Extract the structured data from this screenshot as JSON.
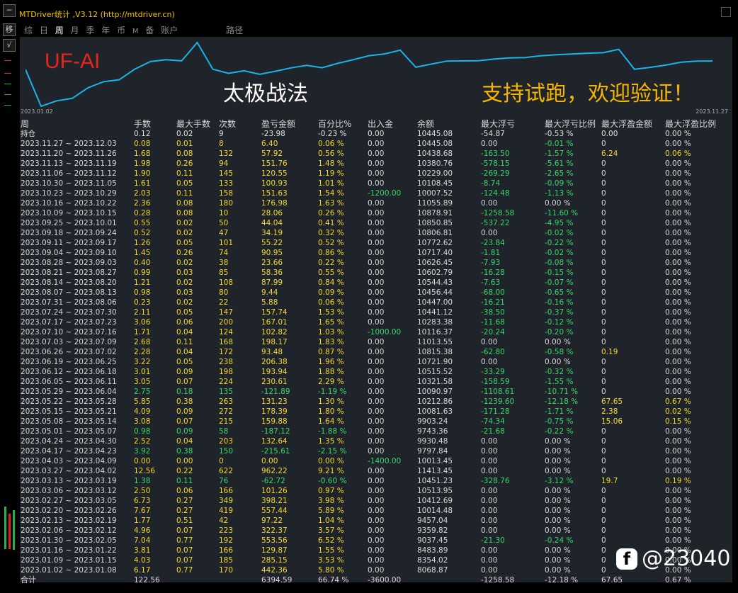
{
  "window": {
    "title": "MTDriver统计 ,V3.12 (http://mtdriver.cn)"
  },
  "left_buttons": [
    "─",
    "移",
    "√"
  ],
  "tabs": [
    {
      "label": "综"
    },
    {
      "label": "日"
    },
    {
      "label": "周",
      "active": true
    },
    {
      "label": "月"
    },
    {
      "label": "季"
    },
    {
      "label": "年"
    },
    {
      "label": "币"
    },
    {
      "label": "M"
    },
    {
      "label": "备"
    },
    {
      "label": "账户"
    },
    {
      "label": "路径"
    }
  ],
  "curve": {
    "start_date": "2023.01.02",
    "end_date": "2023.11.27",
    "line_color": "#19b4e8",
    "balances": [
      10000,
      8068.87,
      8354.02,
      8483.89,
      9037.45,
      9359.82,
      9457.04,
      10014.48,
      10412.69,
      10513.95,
      10451.23,
      11413.45,
      10013.45,
      9797.84,
      9930.48,
      9743.36,
      9903.24,
      10081.63,
      10212.86,
      10090.97,
      10321.58,
      10515.52,
      10721.9,
      10815.38,
      11013.55,
      10116.37,
      10283.38,
      10441.12,
      10447.0,
      10456.44,
      10544.43,
      10602.79,
      10626.45,
      10717.4,
      10772.62,
      10806.81,
      10850.85,
      10878.91,
      11055.89,
      10007.52,
      10108.45,
      10229.0,
      10380.76,
      10438.68,
      10445.08
    ]
  },
  "overlay": {
    "brand": "UF-AI",
    "caption_left": "太极战法",
    "caption_right": "支持试跑，欢迎验证！",
    "brand_color": "#e8241c",
    "caption_right_color": "#f5b400"
  },
  "table": {
    "headers": [
      "周",
      "手数",
      "最大手数",
      "次数",
      "盈亏金额",
      "百分比%",
      "出入金",
      "余额",
      "最大浮亏",
      "最大浮亏比例",
      "最大浮盈金额",
      "最大浮盈比例"
    ],
    "rows": [
      [
        "持仓",
        "0.12",
        "0.02",
        "9",
        "-23.98",
        "-0.23 %",
        "0.00",
        "10445.08",
        "-54.87",
        "-0.53 %",
        "0.00",
        "0.00 %"
      ],
      [
        "2023.11.27 ~ 2023.12.03",
        "0.08",
        "0.01",
        "8",
        "6.40",
        "0.06 %",
        "0.00",
        "10445.08",
        "0.00",
        "-0.01 %",
        "0",
        "0.00 %"
      ],
      [
        "2023.11.20 ~ 2023.11.26",
        "1.68",
        "0.08",
        "132",
        "57.92",
        "0.56 %",
        "0.00",
        "10438.68",
        "-163.50",
        "-1.57 %",
        "6.24",
        "0.06 %"
      ],
      [
        "2023.11.13 ~ 2023.11.19",
        "1.98",
        "0.26",
        "94",
        "151.76",
        "1.48 %",
        "0.00",
        "10380.76",
        "-578.15",
        "-5.61 %",
        "0",
        "0.00 %"
      ],
      [
        "2023.11.06 ~ 2023.11.12",
        "1.90",
        "0.11",
        "145",
        "120.55",
        "1.19 %",
        "0.00",
        "10229.00",
        "-269.29",
        "-2.65 %",
        "0",
        "0.00 %"
      ],
      [
        "2023.10.30 ~ 2023.11.05",
        "1.61",
        "0.05",
        "133",
        "100.93",
        "1.01 %",
        "0.00",
        "10108.45",
        "-8.74",
        "-0.09 %",
        "0",
        "0.00 %"
      ],
      [
        "2023.10.23 ~ 2023.10.29",
        "2.03",
        "0.11",
        "158",
        "151.63",
        "1.54 %",
        "-1200.00",
        "10007.52",
        "-124.48",
        "-1.13 %",
        "0",
        "0.00 %"
      ],
      [
        "2023.10.16 ~ 2023.10.22",
        "2.36",
        "0.08",
        "180",
        "176.98",
        "1.63 %",
        "0.00",
        "11055.89",
        "0.00",
        "0.00 %",
        "0",
        "0.00 %"
      ],
      [
        "2023.10.09 ~ 2023.10.15",
        "0.28",
        "0.08",
        "10",
        "28.06",
        "0.26 %",
        "0.00",
        "10878.91",
        "-1258.58",
        "-11.60 %",
        "0",
        "0.00 %"
      ],
      [
        "2023.09.25 ~ 2023.10.01",
        "0.55",
        "0.02",
        "50",
        "44.04",
        "0.41 %",
        "0.00",
        "10850.85",
        "-537.22",
        "-4.95 %",
        "0",
        "0.00 %"
      ],
      [
        "2023.09.18 ~ 2023.09.24",
        "0.52",
        "0.02",
        "47",
        "34.19",
        "0.32 %",
        "0.00",
        "10806.81",
        "0.00",
        "-0.02 %",
        "0",
        "0.00 %"
      ],
      [
        "2023.09.11 ~ 2023.09.17",
        "1.26",
        "0.05",
        "101",
        "55.22",
        "0.52 %",
        "0.00",
        "10772.62",
        "-23.84",
        "-0.22 %",
        "0",
        "0.00 %"
      ],
      [
        "2023.09.04 ~ 2023.09.10",
        "1.45",
        "0.26",
        "74",
        "90.95",
        "0.86 %",
        "0.00",
        "10717.40",
        "-1.81",
        "-0.02 %",
        "0",
        "0.00 %"
      ],
      [
        "2023.08.28 ~ 2023.09.03",
        "0.40",
        "0.02",
        "38",
        "23.66",
        "0.22 %",
        "0.00",
        "10626.45",
        "-7.93",
        "-0.08 %",
        "0",
        "0.00 %"
      ],
      [
        "2023.08.21 ~ 2023.08.27",
        "0.99",
        "0.03",
        "85",
        "58.36",
        "0.55 %",
        "0.00",
        "10602.79",
        "-16.28",
        "-0.15 %",
        "0",
        "0.00 %"
      ],
      [
        "2023.08.14 ~ 2023.08.20",
        "1.21",
        "0.02",
        "108",
        "87.99",
        "0.84 %",
        "0.00",
        "10544.43",
        "-7.63",
        "-0.07 %",
        "0",
        "0.00 %"
      ],
      [
        "2023.08.07 ~ 2023.08.13",
        "0.98",
        "0.03",
        "80",
        "9.44",
        "0.09 %",
        "0.00",
        "10456.44",
        "-68.00",
        "-0.65 %",
        "0",
        "0.00 %"
      ],
      [
        "2023.07.31 ~ 2023.08.06",
        "0.23",
        "0.02",
        "22",
        "5.88",
        "0.06 %",
        "0.00",
        "10447.00",
        "-16.21",
        "-0.16 %",
        "0",
        "0.00 %"
      ],
      [
        "2023.07.24 ~ 2023.07.30",
        "2.11",
        "0.05",
        "147",
        "157.74",
        "1.53 %",
        "0.00",
        "10441.12",
        "-38.50",
        "-0.37 %",
        "0",
        "0.00 %"
      ],
      [
        "2023.07.17 ~ 2023.07.23",
        "3.06",
        "0.06",
        "200",
        "167.01",
        "1.65 %",
        "0.00",
        "10283.38",
        "-11.68",
        "-0.12 %",
        "0",
        "0.00 %"
      ],
      [
        "2023.07.10 ~ 2023.07.16",
        "1.71",
        "0.04",
        "124",
        "102.82",
        "1.03 %",
        "-1000.00",
        "10116.37",
        "-20.24",
        "-0.20 %",
        "0",
        "0.00 %"
      ],
      [
        "2023.07.03 ~ 2023.07.09",
        "2.68",
        "0.11",
        "168",
        "198.17",
        "1.83 %",
        "0.00",
        "11013.55",
        "0.00",
        "0.00 %",
        "0",
        "0.00 %"
      ],
      [
        "2023.06.26 ~ 2023.07.02",
        "2.28",
        "0.04",
        "172",
        "93.48",
        "0.87 %",
        "0.00",
        "10815.38",
        "-62.80",
        "-0.58 %",
        "0.19",
        "0.00 %"
      ],
      [
        "2023.06.19 ~ 2023.06.25",
        "3.22",
        "0.05",
        "238",
        "206.38",
        "1.96 %",
        "0.00",
        "10721.90",
        "0.00",
        "0.00 %",
        "0",
        "0.00 %"
      ],
      [
        "2023.06.12 ~ 2023.06.18",
        "3.01",
        "0.09",
        "198",
        "193.94",
        "1.88 %",
        "0.00",
        "10515.52",
        "-33.29",
        "-0.32 %",
        "0",
        "0.00 %"
      ],
      [
        "2023.06.05 ~ 2023.06.11",
        "3.05",
        "0.07",
        "224",
        "230.61",
        "2.29 %",
        "0.00",
        "10321.58",
        "-158.59",
        "-1.55 %",
        "0",
        "0.00 %"
      ],
      [
        "2023.05.29 ~ 2023.06.04",
        "2.75",
        "0.18",
        "135",
        "-121.89",
        "-1.19 %",
        "0.00",
        "10090.97",
        "-1108.61",
        "-10.71 %",
        "0",
        "0.00 %"
      ],
      [
        "2023.05.22 ~ 2023.05.28",
        "5.85",
        "0.38",
        "263",
        "131.23",
        "1.30 %",
        "0.00",
        "10212.86",
        "-1239.60",
        "-12.18 %",
        "67.65",
        "0.67 %"
      ],
      [
        "2023.05.15 ~ 2023.05.21",
        "4.09",
        "0.09",
        "272",
        "178.39",
        "1.80 %",
        "0.00",
        "10081.63",
        "-171.28",
        "-1.71 %",
        "2.38",
        "0.02 %"
      ],
      [
        "2023.05.08 ~ 2023.05.14",
        "3.08",
        "0.07",
        "215",
        "159.88",
        "1.64 %",
        "0.00",
        "9903.24",
        "-74.34",
        "-0.75 %",
        "15.06",
        "0.15 %"
      ],
      [
        "2023.05.01 ~ 2023.05.07",
        "0.98",
        "0.09",
        "58",
        "-187.12",
        "-1.88 %",
        "0.00",
        "9743.36",
        "-21.68",
        "-0.22 %",
        "0",
        "0.00 %"
      ],
      [
        "2023.04.24 ~ 2023.04.30",
        "2.52",
        "0.04",
        "203",
        "132.64",
        "1.35 %",
        "0.00",
        "9930.48",
        "0.00",
        "0.00 %",
        "0",
        "0.00 %"
      ],
      [
        "2023.04.17 ~ 2023.04.23",
        "3.92",
        "0.38",
        "150",
        "-215.61",
        "-2.15 %",
        "0.00",
        "9797.84",
        "0.00",
        "0.00 %",
        "0",
        "0.00 %"
      ],
      [
        "2023.04.03 ~ 2023.04.09",
        "0.00",
        "0.00",
        "0",
        "0.00",
        "0.00 %",
        "-1400.00",
        "10013.45",
        "0.00",
        "0.00 %",
        "0",
        "0.00 %"
      ],
      [
        "2023.03.27 ~ 2023.04.02",
        "12.56",
        "0.22",
        "622",
        "962.22",
        "9.21 %",
        "0.00",
        "11413.45",
        "0.00",
        "0.00 %",
        "0",
        "0.00 %"
      ],
      [
        "2023.03.13 ~ 2023.03.19",
        "1.38",
        "0.11",
        "76",
        "-62.72",
        "-0.60 %",
        "0.00",
        "10451.23",
        "-328.76",
        "-3.12 %",
        "19.7",
        "0.19 %"
      ],
      [
        "2023.03.06 ~ 2023.03.12",
        "2.50",
        "0.06",
        "166",
        "101.26",
        "0.97 %",
        "0.00",
        "10513.95",
        "0.00",
        "0.00 %",
        "0",
        "0.00 %"
      ],
      [
        "2023.02.27 ~ 2023.03.05",
        "6.73",
        "0.27",
        "349",
        "398.21",
        "3.98 %",
        "0.00",
        "10412.69",
        "0.00",
        "0.00 %",
        "0",
        "0.00 %"
      ],
      [
        "2023.02.20 ~ 2023.02.26",
        "7.67",
        "0.27",
        "419",
        "557.44",
        "5.89 %",
        "0.00",
        "10014.48",
        "0.00",
        "0.00 %",
        "0",
        "0.00 %"
      ],
      [
        "2023.02.13 ~ 2023.02.19",
        "1.77",
        "0.51",
        "42",
        "97.22",
        "1.04 %",
        "0.00",
        "9457.04",
        "0.00",
        "0.00 %",
        "0",
        "0.00 %"
      ],
      [
        "2023.02.06 ~ 2023.02.12",
        "4.96",
        "0.07",
        "223",
        "322.37",
        "3.57 %",
        "0.00",
        "9359.82",
        "0.00",
        "0.00 %",
        "0",
        "0.00 %"
      ],
      [
        "2023.01.30 ~ 2023.02.05",
        "7.04",
        "0.77",
        "192",
        "553.56",
        "6.52 %",
        "0.00",
        "9037.45",
        "-21.30",
        "-0.24 %",
        "0",
        "0.00 %"
      ],
      [
        "2023.01.16 ~ 2023.01.22",
        "3.81",
        "0.07",
        "166",
        "129.87",
        "1.55 %",
        "0.00",
        "8483.89",
        "0.00",
        "0.00 %",
        "0",
        "0.00 %"
      ],
      [
        "2023.01.09 ~ 2023.01.15",
        "4.03",
        "0.07",
        "185",
        "285.15",
        "3.53 %",
        "0.00",
        "8354.02",
        "0.00",
        "0.00 %",
        "0",
        "0.00 %"
      ],
      [
        "2023.01.02 ~ 2023.01.08",
        "6.17",
        "0.77",
        "170",
        "442.36",
        "5.80 %",
        "0.00",
        "8068.87",
        "0.00",
        "0.00 %",
        "0",
        "0.00 %"
      ]
    ],
    "total": [
      "合计",
      "122.56",
      "",
      "",
      "6394.59",
      "66.74 %",
      "-3600.00",
      "",
      "-1258.58",
      "-12.18 %",
      "67.65",
      "0.67 %"
    ]
  },
  "watermark": {
    "icon": "f",
    "text": "@23040"
  }
}
